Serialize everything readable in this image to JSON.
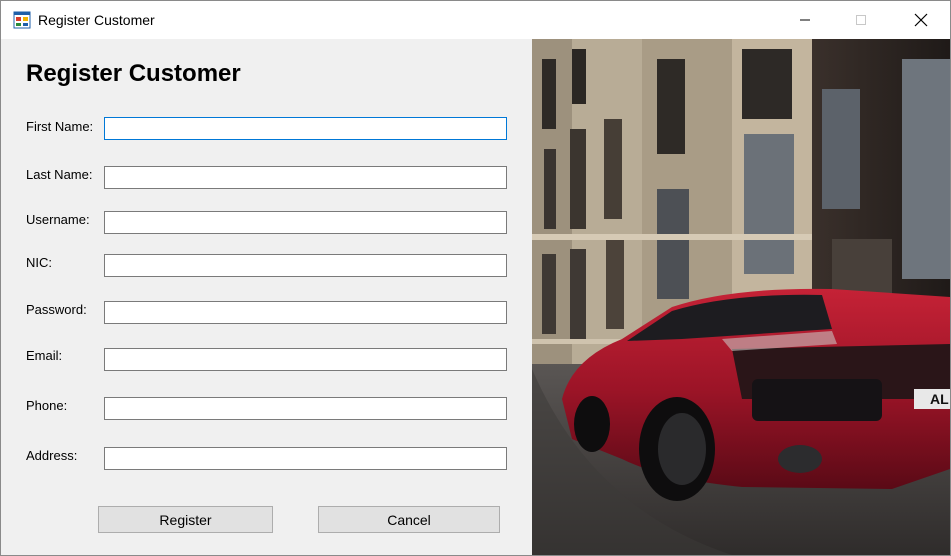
{
  "window": {
    "title": "Register Customer"
  },
  "form": {
    "heading": "Register Customer",
    "fields": [
      {
        "label": "First Name:",
        "value": ""
      },
      {
        "label": "Last Name:",
        "value": ""
      },
      {
        "label": "Username:",
        "value": ""
      },
      {
        "label": "NIC:",
        "value": ""
      },
      {
        "label": "Password:",
        "value": ""
      },
      {
        "label": "Email:",
        "value": ""
      },
      {
        "label": "Phone:",
        "value": ""
      },
      {
        "label": "Address:",
        "value": ""
      }
    ],
    "register_label": "Register",
    "cancel_label": "Cancel"
  },
  "photo": {
    "plate_text": "AL"
  },
  "colors": {
    "focus_border": "#0078d7",
    "car_red": "#a8182b",
    "window_bg": "#f0f0f0"
  }
}
